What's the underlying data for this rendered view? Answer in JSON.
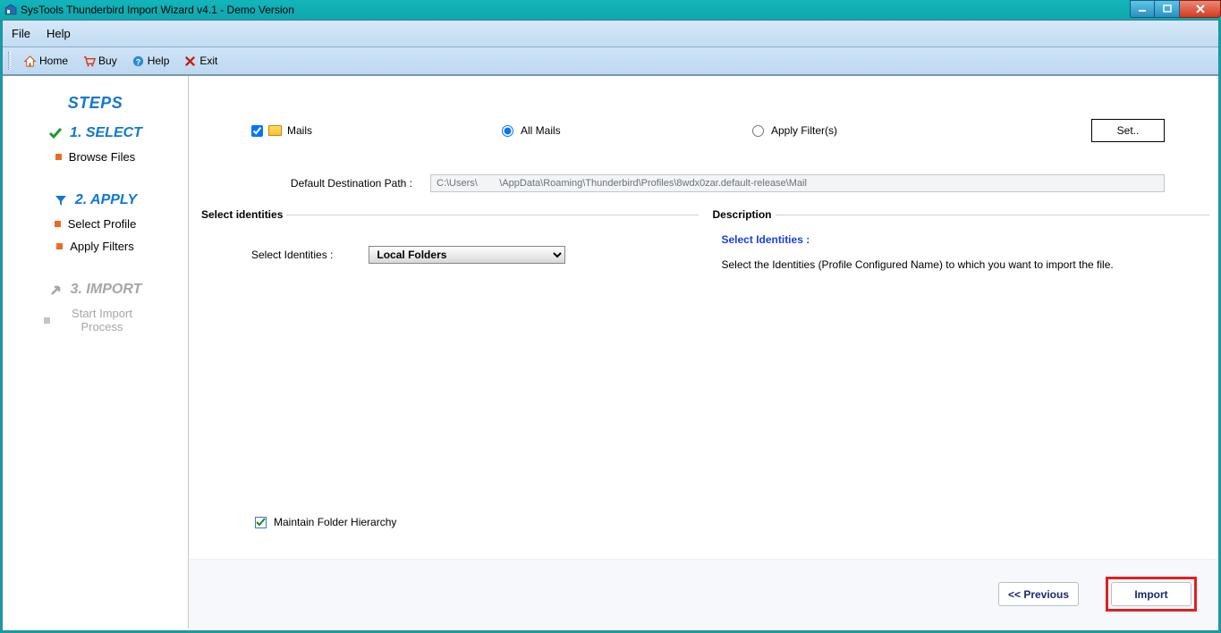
{
  "window": {
    "title": "SysTools Thunderbird Import Wizard v4.1 - Demo Version"
  },
  "menubar": {
    "file": "File",
    "help": "Help"
  },
  "toolbar": {
    "home": "Home",
    "buy": "Buy",
    "help": "Help",
    "exit": "Exit"
  },
  "sidebar": {
    "heading": "STEPS",
    "step1": {
      "label": "1. SELECT",
      "sub1": "Browse Files"
    },
    "step2": {
      "label": "2. APPLY",
      "sub1": "Select Profile",
      "sub2": "Apply Filters"
    },
    "step3": {
      "label": "3. IMPORT",
      "sub1": "Start Import Process"
    }
  },
  "filter": {
    "mails_label": "Mails",
    "allmails_label": "All Mails",
    "applyfilter_label": "Apply Filter(s)",
    "set_label": "Set.."
  },
  "destination": {
    "label": "Default Destination Path :",
    "value": "C:\\Users\\        \\AppData\\Roaming\\Thunderbird\\Profiles\\8wdx0zar.default-release\\Mail"
  },
  "panel_left": {
    "title": "Select identities",
    "label": "Select Identities :",
    "selected": "Local Folders"
  },
  "panel_right": {
    "title": "Description",
    "heading": "Select Identities :",
    "text": "Select the Identities (Profile Configured Name) to  which  you want to import the file."
  },
  "maintain": {
    "label": "Maintain Folder Hierarchy"
  },
  "footer": {
    "prev": "<< Previous",
    "import": "Import"
  }
}
